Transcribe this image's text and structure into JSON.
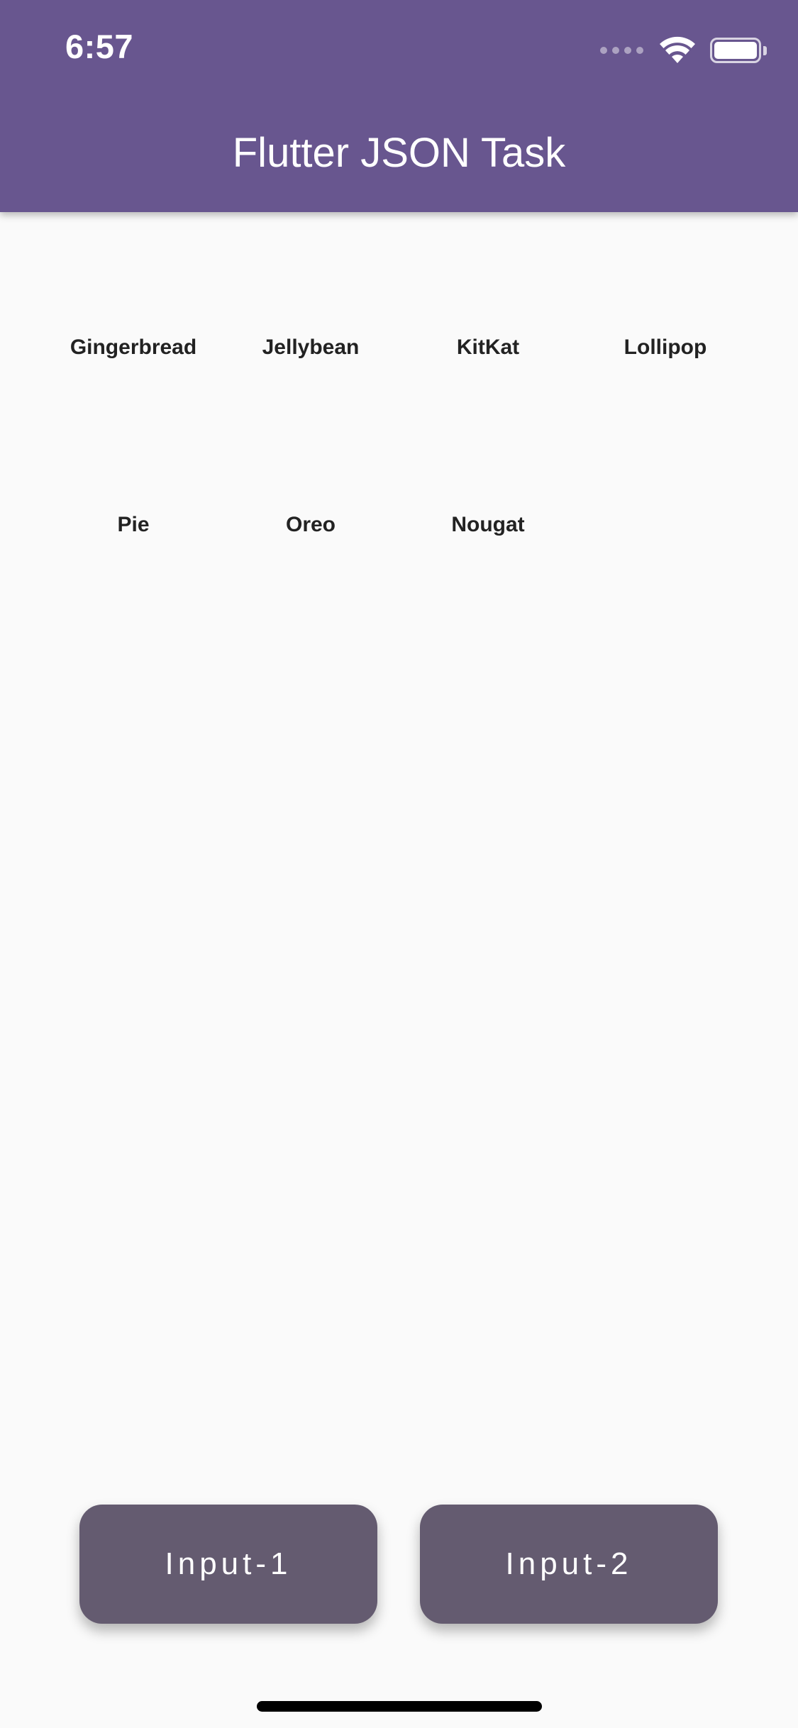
{
  "status_bar": {
    "time": "6:57",
    "icons": [
      "cellular-signal-icon",
      "wifi-icon",
      "battery-icon"
    ]
  },
  "app_bar": {
    "title": "Flutter JSON Task",
    "color": "#68568f"
  },
  "grid": {
    "items": [
      {
        "label": "Gingerbread"
      },
      {
        "label": "Jellybean"
      },
      {
        "label": "KitKat"
      },
      {
        "label": "Lollipop"
      },
      {
        "label": "Pie"
      },
      {
        "label": "Oreo"
      },
      {
        "label": "Nougat"
      }
    ]
  },
  "buttons": {
    "input1_label": "Input-1",
    "input2_label": "Input-2",
    "color": "#645b70"
  }
}
